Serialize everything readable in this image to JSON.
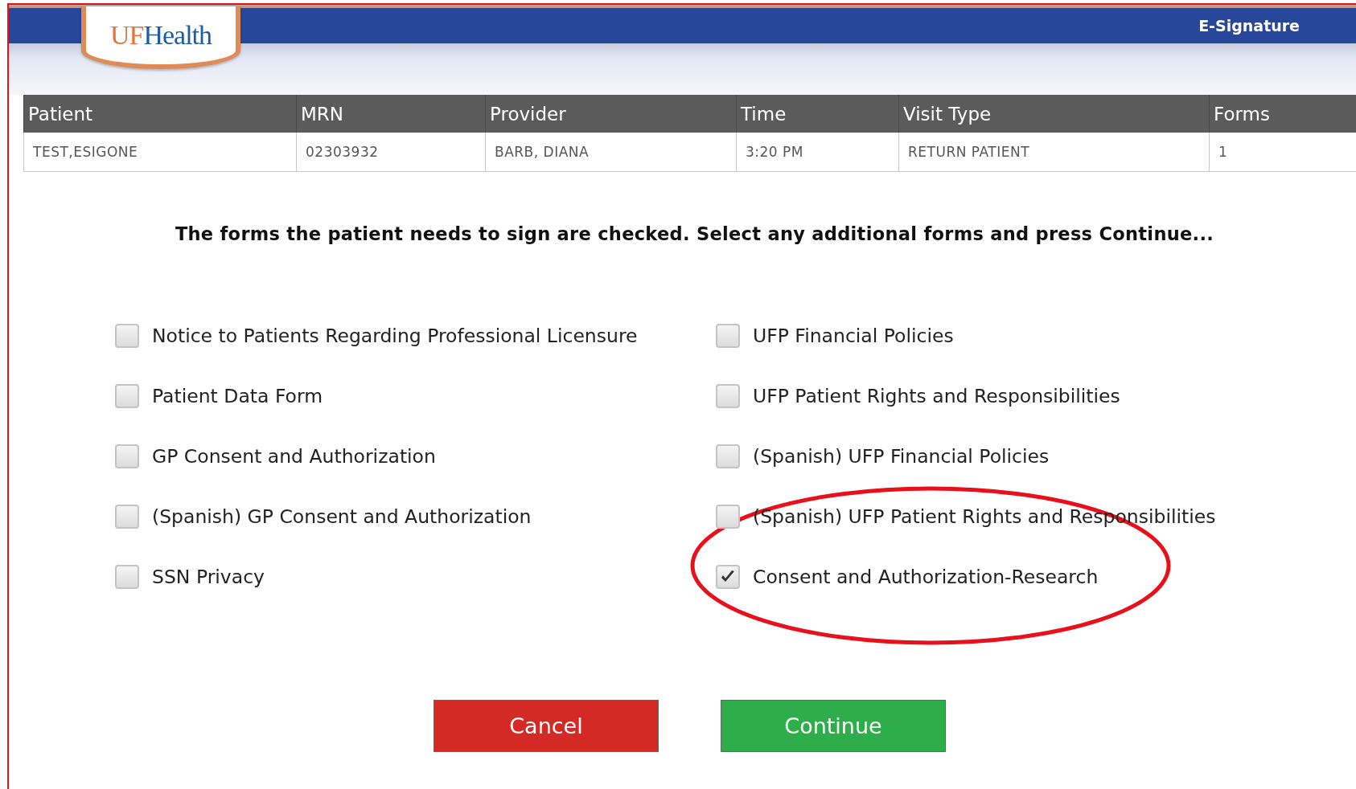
{
  "header": {
    "logo": {
      "first": "UF",
      "second": "Health"
    },
    "title": "E-Signature"
  },
  "table": {
    "columns": [
      "Patient",
      "MRN",
      "Provider",
      "Time",
      "Visit Type",
      "Forms"
    ],
    "rows": [
      [
        "TEST,ESIGONE",
        "02303932",
        "BARB, DIANA",
        "3:20 PM",
        "RETURN PATIENT",
        "1"
      ]
    ]
  },
  "instruction": "The forms the patient needs to sign are checked. Select any additional forms and press Continue...",
  "form_columns": [
    {
      "items": [
        {
          "label": "Notice to Patients Regarding Professional Licensure",
          "checked": false
        },
        {
          "label": "Patient Data Form",
          "checked": false
        },
        {
          "label": "GP Consent and Authorization",
          "checked": false
        },
        {
          "label": "(Spanish) GP Consent and Authorization",
          "checked": false
        },
        {
          "label": "SSN Privacy",
          "checked": false
        }
      ]
    },
    {
      "items": [
        {
          "label": "UFP Financial Policies",
          "checked": false
        },
        {
          "label": "UFP Patient Rights and Responsibilities",
          "checked": false
        },
        {
          "label": "(Spanish) UFP Financial Policies",
          "checked": false
        },
        {
          "label": "(Spanish) UFP Patient Rights and Responsibilities",
          "checked": false
        },
        {
          "label": "Consent and Authorization-Research",
          "checked": true
        }
      ]
    }
  ],
  "buttons": [
    {
      "label": "Cancel",
      "kind": "cancel"
    },
    {
      "label": "Continue",
      "kind": "continue"
    }
  ],
  "annotation": {
    "kind": "ellipse"
  }
}
